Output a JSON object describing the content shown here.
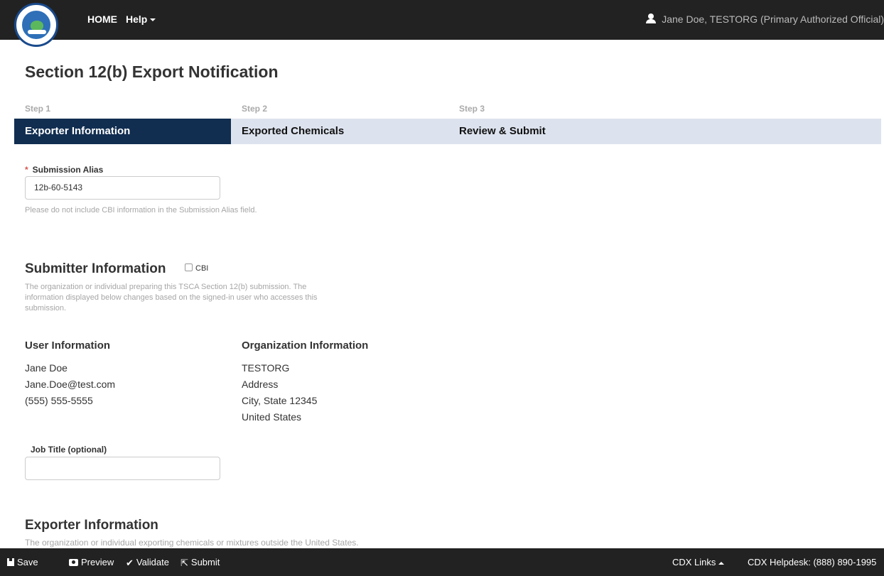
{
  "nav": {
    "logo_alt": "EPA",
    "home": "HOME",
    "help": "Help",
    "user": "Jane Doe, TESTORG (Primary Authorized Official)"
  },
  "page": {
    "title": "Section 12(b) Export Notification"
  },
  "steps": [
    {
      "step": "Step 1",
      "label": "Exporter Information",
      "active": true
    },
    {
      "step": "Step 2",
      "label": "Exported Chemicals",
      "active": false
    },
    {
      "step": "Step 3",
      "label": "Review & Submit",
      "active": false
    }
  ],
  "alias": {
    "label": "Submission Alias",
    "value": "12b-60-5143",
    "help": "Please do not include CBI information in the Submission Alias field."
  },
  "submitter": {
    "title": "Submitter Information",
    "cbi": "CBI",
    "description_line1": "The organization or individual preparing this TSCA Section 12(b) submission. The",
    "description_line2": "information displayed below changes based on the signed-in user who accesses this",
    "description_line3": "submission."
  },
  "user_info": {
    "heading": "User Information",
    "name": "Jane Doe",
    "email": "Jane.Doe@test.com",
    "phone": "(555) 555-5555"
  },
  "org_info": {
    "heading": "Organization Information",
    "name": "TESTORG",
    "address": "Address",
    "city_state": "City, State 12345",
    "country": "United States"
  },
  "job_title": {
    "label": "Job Title (optional)",
    "value": ""
  },
  "exporter": {
    "title": "Exporter Information",
    "description": "The organization or individual exporting chemicals or mixtures outside the United States."
  },
  "footer": {
    "save": "Save",
    "preview": "Preview",
    "validate": "Validate",
    "submit": "Submit",
    "cdx_links": "CDX Links",
    "helpdesk": "CDX Helpdesk: (888) 890-1995"
  }
}
